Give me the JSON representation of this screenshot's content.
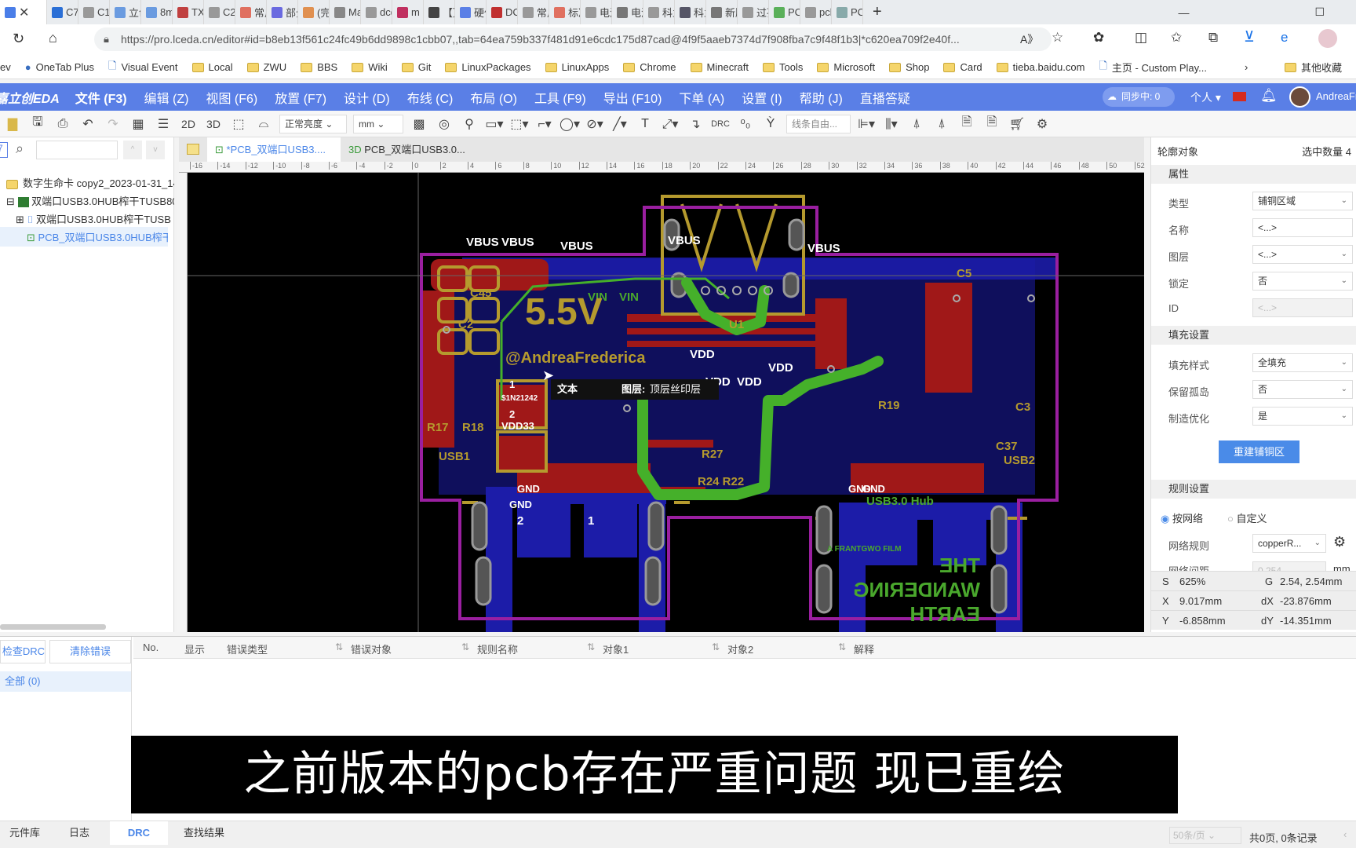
{
  "browser": {
    "tabs": [
      "",
      "C70",
      "C15",
      "立创",
      "8m",
      "TX4",
      "C29",
      "常用",
      "部分",
      "(完)",
      "Ma",
      "dcd",
      "m",
      "【】",
      "硬件",
      "DC",
      "常用",
      "标准",
      "电源",
      "电源",
      "科兰",
      "科兰",
      "新版",
      "过孔",
      "PCB",
      "pcb",
      "PCB"
    ],
    "url": "https://pro.lceda.cn/editor#id=b8eb13f561c24fc49b6dd9898c1cbb07,,tab=64ea759b337f481d91e6cdc175d87cad@4f9f5aaeb7374d7f908fba7c9f48f1b3|*c620ea709f2e40f...",
    "bookmarks": [
      "ev",
      "OneTab Plus",
      "Visual Event",
      "Local",
      "ZWU",
      "BBS",
      "Wiki",
      "Git",
      "LinuxPackages",
      "LinuxApps",
      "Chrome",
      "Minecraft",
      "Tools",
      "Microsoft",
      "Shop",
      "Card",
      "tieba.baidu.com",
      "主页 - Custom Play...",
      "其他收藏"
    ]
  },
  "app": {
    "logo": "嘉立创EDA",
    "menus": [
      "文件 (F3)",
      "编辑 (Z)",
      "视图 (F6)",
      "放置 (F7)",
      "设计 (D)",
      "布线 (C)",
      "布局 (O)",
      "工具 (F9)",
      "导出 (F10)",
      "下单 (A)",
      "设置 (I)",
      "帮助 (J)",
      "直播答疑"
    ],
    "sync": "同步中: 0",
    "personal": "个人",
    "user": "AndreaFrederica",
    "accent": "#5a7fe6"
  },
  "toolbar": {
    "view2d": "2D",
    "view3d": "3D",
    "brightness": "正常亮度",
    "unit": "mm",
    "drc": "DRC",
    "line_mode": "线条自由..."
  },
  "left": {
    "tree": [
      "数字生命卡 copy2_2023-01-31_14",
      "双端口USB3.0HUB榨干TUSB8041",
      "双端口USB3.0HUB榨干TUSB",
      "PCB_双端口USB3.0HUB榨干"
    ]
  },
  "doc_tabs": [
    "*PCB_双端口USB3....",
    "PCB_双端口USB3.0..."
  ],
  "doc_tab_3d": "3D",
  "ruler": [
    "-16",
    "-14",
    "-12",
    "-10",
    "-8",
    "-6",
    "-4",
    "-2",
    "0",
    "2",
    "4",
    "6",
    "8",
    "10",
    "12",
    "14",
    "16",
    "18",
    "20",
    "22",
    "24",
    "26",
    "28",
    "30",
    "32",
    "34",
    "36",
    "38",
    "40",
    "42",
    "44",
    "46",
    "48",
    "50",
    "52"
  ],
  "pcb": {
    "labels": [
      "VBUS",
      "VBUS",
      "VBUS",
      "VBUS",
      "VBUS",
      "VIN",
      "VIN",
      "VDD",
      "VDD",
      "VDD",
      "VDD",
      "GND",
      "GND",
      "GND",
      "GND",
      "USB1",
      "USB2",
      "U1",
      "R17",
      "R18",
      "C2",
      "C45",
      "C5",
      "C3",
      "C37",
      "R27",
      "R24 R22",
      "R19",
      "VDD33",
      "1",
      "2",
      "$1N21242",
      "@AndreaFrederica",
      "5.5V",
      "USB3.0 Hub",
      "THE WANDERING EARTH",
      "A FRANTGWO FILM",
      "2",
      "1"
    ],
    "tooltip": {
      "type": "文本",
      "layer_label": "图层:",
      "layer": "顶层丝印层"
    }
  },
  "right": {
    "title": "轮廓对象",
    "selected": "选中数量 4",
    "sections": [
      "属性",
      "填充设置",
      "规则设置"
    ],
    "props": [
      {
        "label": "类型",
        "value": "铺铜区域"
      },
      {
        "label": "名称",
        "value": "<...>"
      },
      {
        "label": "图层",
        "value": "<...>"
      },
      {
        "label": "锁定",
        "value": "否"
      },
      {
        "label": "ID",
        "value": "<...>"
      }
    ],
    "fill": [
      {
        "label": "填充样式",
        "value": "全填充"
      },
      {
        "label": "保留孤岛",
        "value": "否"
      },
      {
        "label": "制造优化",
        "value": "是"
      }
    ],
    "rebuild": "重建铺铜区",
    "radio": [
      "按网络",
      "自定义"
    ],
    "net_rule_label": "网络规则",
    "net_rule": "copperR...",
    "net_gap_label": "网络间距",
    "net_gap": "0.254",
    "net_gap_unit": "mm",
    "status": {
      "S": "625%",
      "G": "2.54, 2.54mm",
      "X": "9.017mm",
      "dX": "-23.876mm",
      "Y": "-6.858mm",
      "dY": "-14.351mm"
    }
  },
  "drc": {
    "check": "检查DRC",
    "clear": "清除错误",
    "all": "全部 (0)",
    "columns": [
      "No.",
      "显示",
      "错误类型",
      "错误对象",
      "规则名称",
      "对象1",
      "对象2",
      "解释"
    ]
  },
  "bottom": {
    "tabs": [
      "元件库",
      "日志",
      "DRC",
      "查找结果"
    ],
    "per_page": "50条/页",
    "summary": "共0页, 0条记录"
  },
  "subtitle": "之前版本的pcb存在严重问题 现已重绘"
}
